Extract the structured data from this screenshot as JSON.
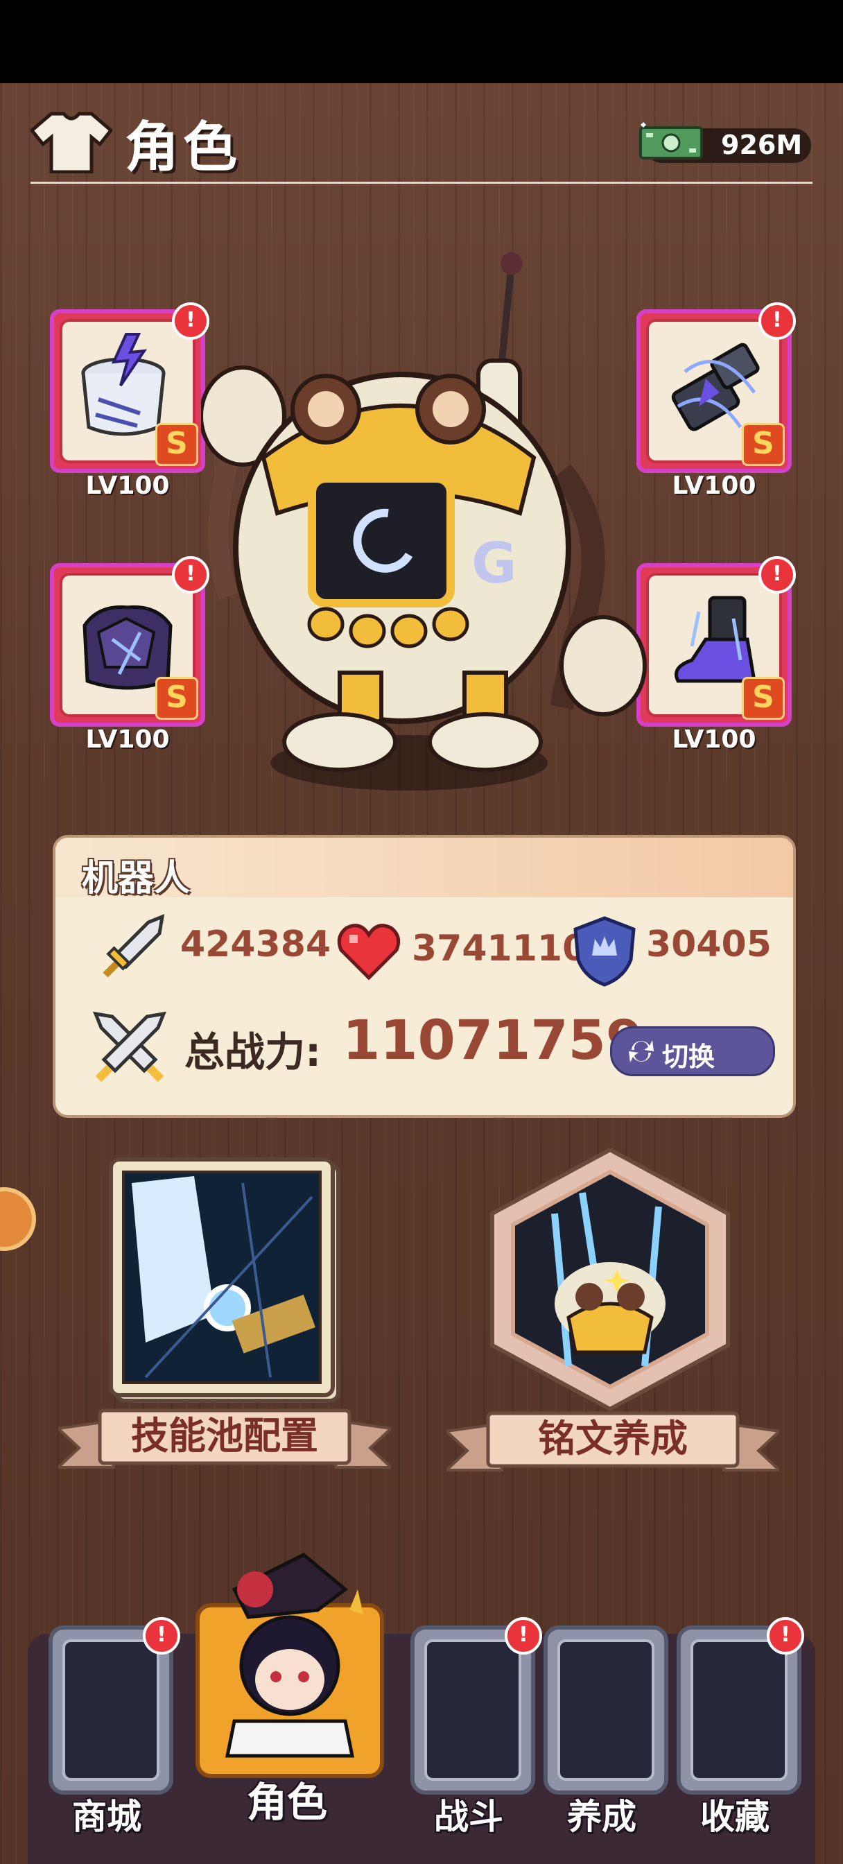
{
  "header": {
    "title": "角色",
    "currency": "926M"
  },
  "equipment": [
    {
      "name": "energy-drum",
      "level": "LV100",
      "grade": "S",
      "alert": "!"
    },
    {
      "name": "arm-cannon",
      "level": "LV100",
      "grade": "S",
      "alert": "!"
    },
    {
      "name": "armor-chest",
      "level": "LV100",
      "grade": "S",
      "alert": "!"
    },
    {
      "name": "boot",
      "level": "LV100",
      "grade": "S",
      "alert": "!"
    }
  ],
  "stats": {
    "title": "机器人",
    "attack": "424384",
    "hp": "3741110",
    "defense": "30405",
    "power_label": "总战力:",
    "power_value": "11071759",
    "switch_label": "切换"
  },
  "features": {
    "skill_pool": "技能池配置",
    "inscription": "铭文养成"
  },
  "nav": [
    {
      "label": "商城",
      "alert": "!",
      "active": false
    },
    {
      "label": "角色",
      "alert": "",
      "active": true
    },
    {
      "label": "战斗",
      "alert": "!",
      "active": false
    },
    {
      "label": "养成",
      "alert": "",
      "active": false
    },
    {
      "label": "收藏",
      "alert": "!",
      "active": false
    }
  ],
  "colors": {
    "accent_red": "#e03a5a",
    "stat_value": "#9a4836",
    "switch_button": "#5c559a",
    "nav_active": "#f0a22a"
  }
}
